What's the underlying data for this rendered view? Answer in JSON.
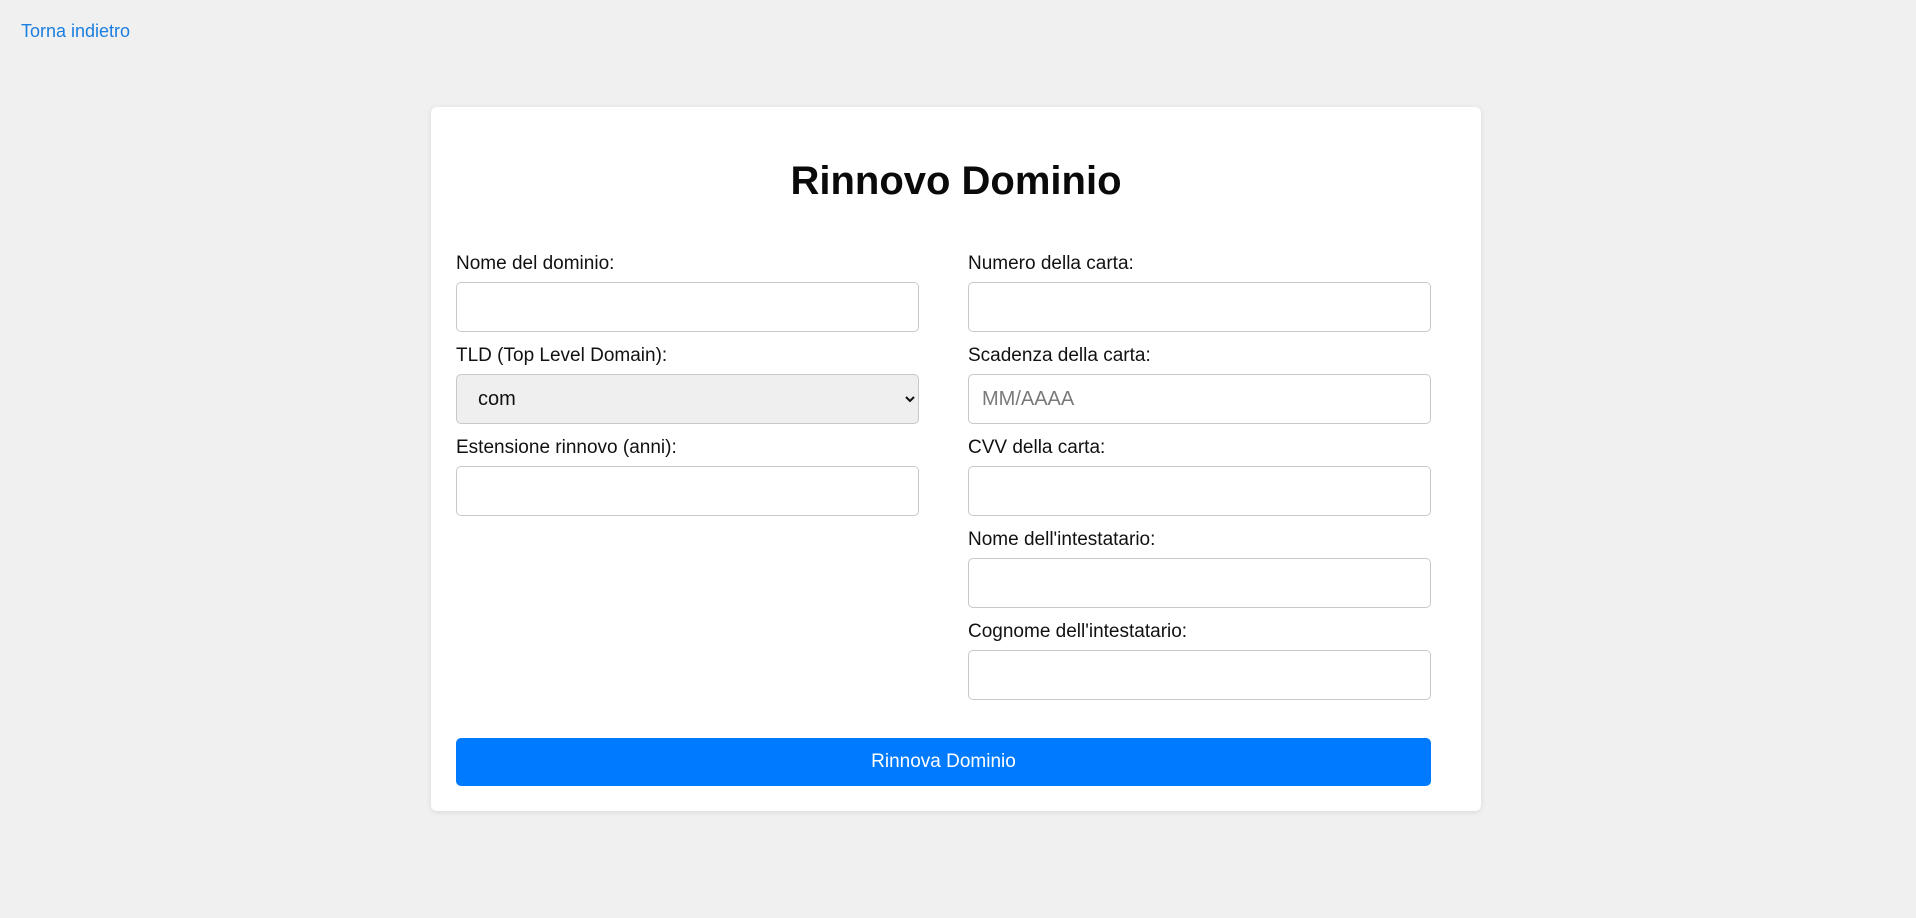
{
  "nav": {
    "back_label": "Torna indietro"
  },
  "form": {
    "title": "Rinnovo Dominio",
    "left_fields": {
      "domain_name": {
        "label": "Nome del dominio:",
        "value": "",
        "placeholder": ""
      },
      "tld": {
        "label": "TLD (Top Level Domain):",
        "selected": "com"
      },
      "renewal_years": {
        "label": "Estensione rinnovo (anni):",
        "value": "",
        "placeholder": ""
      }
    },
    "right_fields": {
      "card_number": {
        "label": "Numero della carta:",
        "value": "",
        "placeholder": ""
      },
      "card_expiry": {
        "label": "Scadenza della carta:",
        "value": "",
        "placeholder": "MM/AAAA"
      },
      "card_cvv": {
        "label": "CVV della carta:",
        "value": "",
        "placeholder": ""
      },
      "holder_first_name": {
        "label": "Nome dell'intestatario:",
        "value": "",
        "placeholder": ""
      },
      "holder_last_name": {
        "label": "Cognome dell'intestatario:",
        "value": "",
        "placeholder": ""
      }
    },
    "submit_label": "Rinnova Dominio"
  },
  "colors": {
    "accent": "#007bff",
    "link": "#1a7fe0",
    "background": "#f0f0f0",
    "card": "#ffffff"
  }
}
